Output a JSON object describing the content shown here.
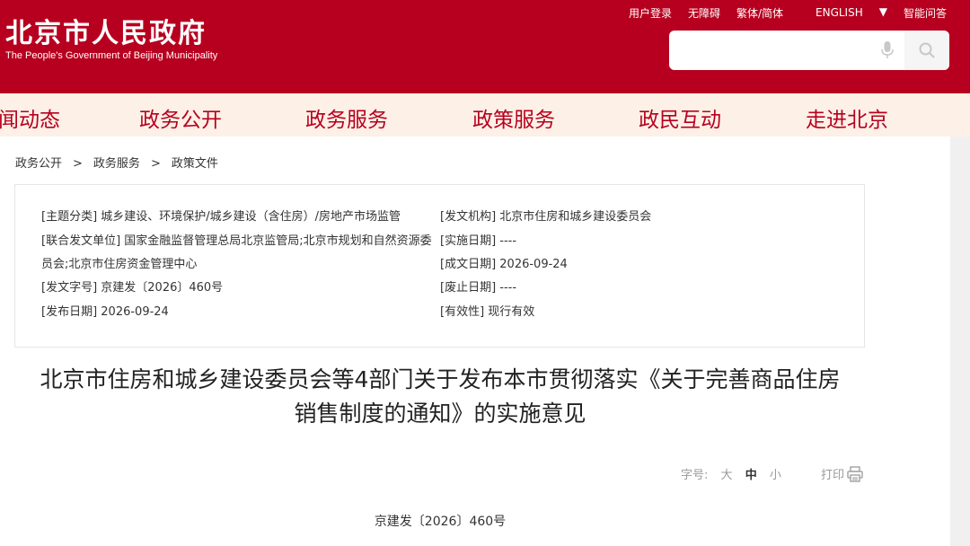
{
  "header": {
    "logo_cn": "北京市人民政府",
    "logo_en": "The People's Government of Beijing Municipality",
    "links": [
      "用户登录",
      "无障碍",
      "繁体/简体",
      "ENGLISH",
      "智能问答"
    ],
    "search_placeholder": ""
  },
  "nav": {
    "items": [
      "闻动态",
      "政务公开",
      "政务服务",
      "政策服务",
      "政民互动",
      "走进北京"
    ]
  },
  "breadcrumb": [
    "政务公开",
    "政务服务",
    "政策文件"
  ],
  "info": {
    "subject": "[主题分类] 城乡建设、环境保护/城乡建设（含住房）/房地产市场监管",
    "issuer": "[发文机构] 北京市住房和城乡建设委员会",
    "co_issuer_1": "[联合发文单位] 国家金融监督管理总局北京监管局;北京市规划和自然资源委",
    "co_issuer_2": "员会;北京市住房资金管理中心",
    "effective_date": "[实施日期] ----",
    "written_date": "[成文日期] 2026-09-24",
    "doc_no": "[发文字号] 京建发〔2026〕460号",
    "abolish_date": "[废止日期] ----",
    "publish_date": "[发布日期] 2026-09-24",
    "validity": "[有效性] 现行有效"
  },
  "article": {
    "title_line1": "北京市住房和城乡建设委员会等4部门关于发布本市贯彻落实《关于完善商品住房",
    "title_line2": "销售制度的通知》的实施意见",
    "fontsize_label": "字号:",
    "fontsize_options": [
      "大",
      "中",
      "小"
    ],
    "fontsize_selected": "中",
    "print_label": "打印",
    "doc_number": "京建发〔2026〕460号"
  },
  "colors": {
    "brand_red": "#b7001f",
    "nav_bg": "#fdf0e6"
  }
}
